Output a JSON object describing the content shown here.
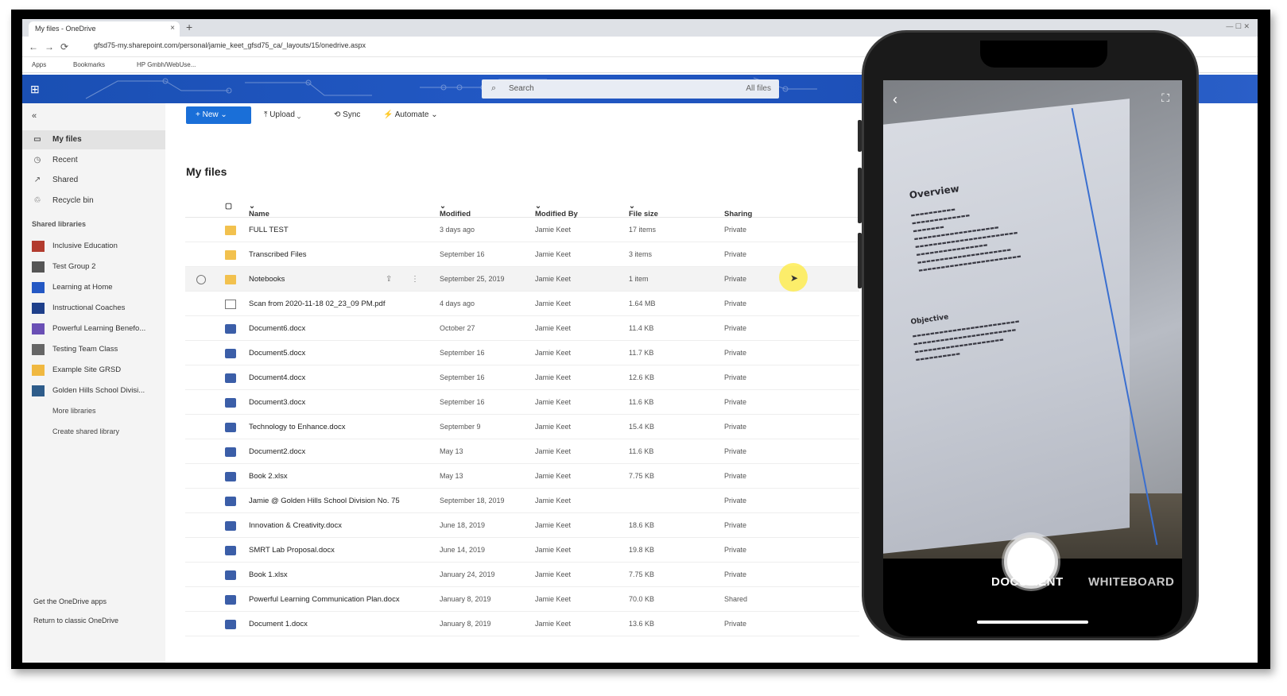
{
  "browser": {
    "tab_title": "My files - OneDrive",
    "tab_close": "×",
    "new_tab": "+",
    "url": "gfsd75-my.sharepoint.com/personal/jamie_keet_gfsd75_ca/_layouts/15/onedrive.aspx",
    "bookmarks": [
      "Apps",
      "Bookmarks",
      "HP Gmbh/WebUse..."
    ]
  },
  "header": {
    "search_placeholder": "Search",
    "search_scope": "All files"
  },
  "sidebar": {
    "collapse_label": "«",
    "nav": [
      {
        "label": "My files",
        "icon": "folder-icon"
      },
      {
        "label": "Recent",
        "icon": "clock-icon"
      },
      {
        "label": "Shared",
        "icon": "share-icon"
      },
      {
        "label": "Recycle bin",
        "icon": "recycle-bin-icon"
      }
    ],
    "section_title": "Shared libraries",
    "libraries": [
      {
        "label": "Inclusive Education",
        "color": "#b23b2e"
      },
      {
        "label": "Test Group 2",
        "color": "#555555"
      },
      {
        "label": "Learning at Home",
        "color": "#2458c4"
      },
      {
        "label": "Instructional Coaches",
        "color": "#1e3f8a"
      },
      {
        "label": "Powerful Learning Benefo...",
        "color": "#6a4fb5"
      },
      {
        "label": "Testing Team Class",
        "color": "#666666"
      },
      {
        "label": "Example Site GRSD",
        "color": "#f0b840"
      },
      {
        "label": "Golden Hills School Divisi...",
        "color": "#2e5c8a"
      }
    ],
    "more_libraries": "More libraries",
    "create_library": "Create shared library",
    "footer_get_apps": "Get the OneDrive apps",
    "footer_classic": "Return to classic OneDrive"
  },
  "commands": {
    "new": "New",
    "upload": "Upload",
    "sync": "Sync",
    "automate": "Automate"
  },
  "page_title": "My files",
  "columns": {
    "name": "Name",
    "modified": "Modified",
    "modified_by": "Modified By",
    "file_size": "File size",
    "sharing": "Sharing"
  },
  "files": [
    {
      "name": "FULL TEST",
      "type": "folder",
      "modified": "3 days ago",
      "by": "Jamie Keet",
      "size": "17 items",
      "sharing": "Private"
    },
    {
      "name": "Transcribed Files",
      "type": "folder",
      "modified": "September 16",
      "by": "Jamie Keet",
      "size": "3 items",
      "sharing": "Private"
    },
    {
      "name": "Notebooks",
      "type": "folder",
      "modified": "September 25, 2019",
      "by": "Jamie Keet",
      "size": "1 item",
      "sharing": "Private"
    },
    {
      "name": "Scan from 2020-11-18 02_23_09 PM.pdf",
      "type": "pdf",
      "modified": "4 days ago",
      "by": "Jamie Keet",
      "size": "1.64 MB",
      "sharing": "Private"
    },
    {
      "name": "Document6.docx",
      "type": "word",
      "modified": "October 27",
      "by": "Jamie Keet",
      "size": "11.4 KB",
      "sharing": "Private"
    },
    {
      "name": "Document5.docx",
      "type": "word",
      "modified": "September 16",
      "by": "Jamie Keet",
      "size": "11.7 KB",
      "sharing": "Private"
    },
    {
      "name": "Document4.docx",
      "type": "word",
      "modified": "September 16",
      "by": "Jamie Keet",
      "size": "12.6 KB",
      "sharing": "Private"
    },
    {
      "name": "Document3.docx",
      "type": "word",
      "modified": "September 16",
      "by": "Jamie Keet",
      "size": "11.6 KB",
      "sharing": "Private"
    },
    {
      "name": "Technology to Enhance.docx",
      "type": "word",
      "modified": "September 9",
      "by": "Jamie Keet",
      "size": "15.4 KB",
      "sharing": "Private"
    },
    {
      "name": "Document2.docx",
      "type": "word",
      "modified": "May 13",
      "by": "Jamie Keet",
      "size": "11.6 KB",
      "sharing": "Private"
    },
    {
      "name": "Book 2.xlsx",
      "type": "word",
      "modified": "May 13",
      "by": "Jamie Keet",
      "size": "7.75 KB",
      "sharing": "Private"
    },
    {
      "name": "Jamie @ Golden Hills School Division No. 75",
      "type": "word",
      "modified": "September 18, 2019",
      "by": "Jamie Keet",
      "size": "",
      "sharing": "Private"
    },
    {
      "name": "Innovation & Creativity.docx",
      "type": "word",
      "modified": "June 18, 2019",
      "by": "Jamie Keet",
      "size": "18.6 KB",
      "sharing": "Private"
    },
    {
      "name": "SMRT Lab Proposal.docx",
      "type": "word",
      "modified": "June 14, 2019",
      "by": "Jamie Keet",
      "size": "19.8 KB",
      "sharing": "Private"
    },
    {
      "name": "Book 1.xlsx",
      "type": "word",
      "modified": "January 24, 2019",
      "by": "Jamie Keet",
      "size": "7.75 KB",
      "sharing": "Private"
    },
    {
      "name": "Powerful Learning Communication Plan.docx",
      "type": "word",
      "modified": "January 8, 2019",
      "by": "Jamie Keet",
      "size": "70.0 KB",
      "sharing": "Shared"
    },
    {
      "name": "Document 1.docx",
      "type": "word",
      "modified": "January 8, 2019",
      "by": "Jamie Keet",
      "size": "13.6 KB",
      "sharing": "Private"
    }
  ],
  "phone": {
    "doc_heading": "Overview",
    "doc_subheading": "Objective",
    "mode_document": "DOCUMENT",
    "mode_whiteboard": "WHITEBOARD",
    "back": "‹",
    "crop": "⛶"
  }
}
